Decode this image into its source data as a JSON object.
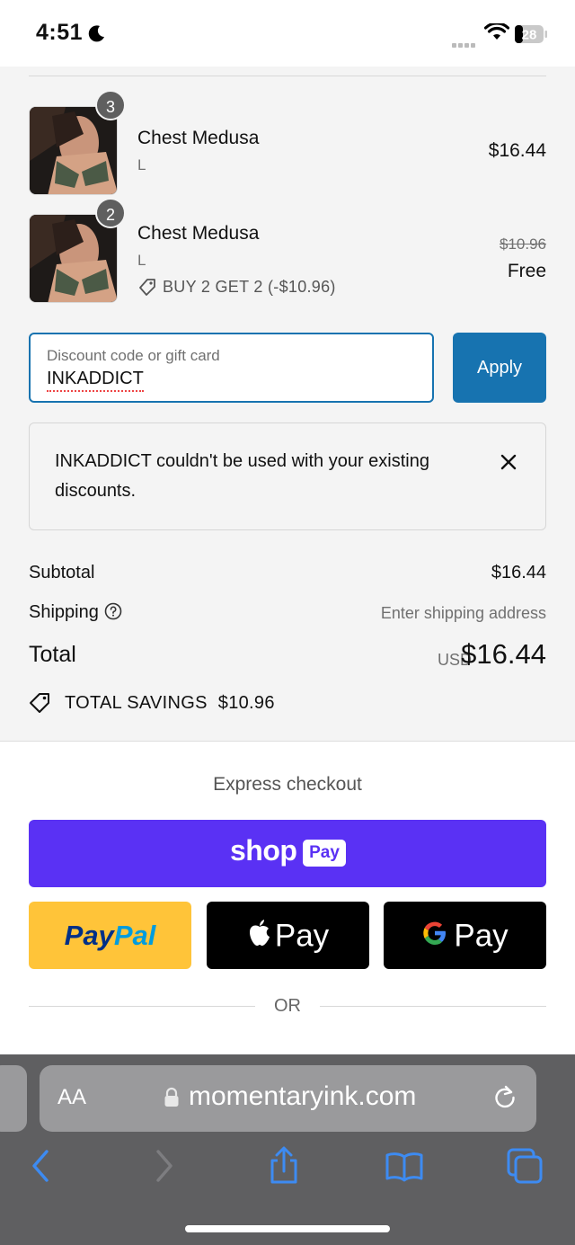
{
  "status_bar": {
    "time": "4:51",
    "battery": "28"
  },
  "items": [
    {
      "quantity": "3",
      "name": "Chest Medusa",
      "variant": "L",
      "price": "$16.44"
    },
    {
      "quantity": "2",
      "name": "Chest Medusa",
      "variant": "L",
      "original_price": "$10.96",
      "price": "Free",
      "promo": "BUY 2 GET 2 (-$10.96)"
    }
  ],
  "discount": {
    "placeholder": "Discount code or gift card",
    "value": "INKADDICT",
    "apply_label": "Apply"
  },
  "error": {
    "message": "INKADDICT couldn't be used with your existing discounts."
  },
  "summary": {
    "subtotal_label": "Subtotal",
    "subtotal_value": "$16.44",
    "shipping_label": "Shipping",
    "shipping_value": "Enter shipping address",
    "total_label": "Total",
    "currency": "USD",
    "total_value": "$16.44",
    "savings_label": "TOTAL SAVINGS",
    "savings_value": "$10.96"
  },
  "express": {
    "title": "Express checkout",
    "shop_word": "shop",
    "shop_badge": "Pay",
    "paypal_part1": "Pay",
    "paypal_part2": "Pal",
    "apple_pay_label": "Pay",
    "google_pay_label": "Pay",
    "or_label": "OR"
  },
  "browser": {
    "aa_label": "AA",
    "url": "momentaryink.com"
  },
  "colors": {
    "accent": "#1773b0",
    "shop_pay": "#5a31f4",
    "paypal_yellow": "#ffc439",
    "browser_blue": "#3d8bf2"
  }
}
